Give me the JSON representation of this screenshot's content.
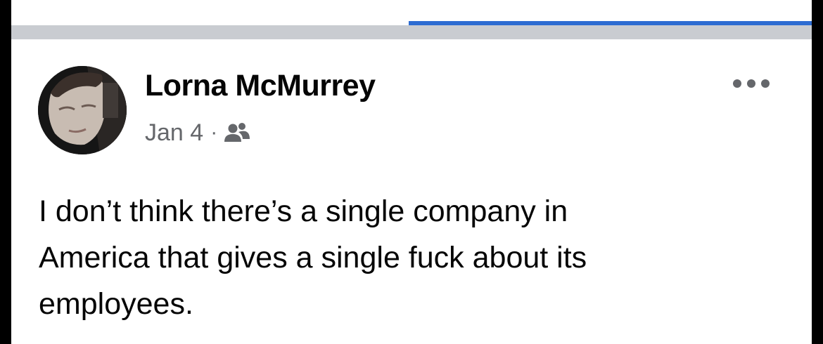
{
  "post": {
    "author": "Lorna McMurrey",
    "date": "Jan 4",
    "separator": "·",
    "audience_icon": "friends-icon",
    "more_icon": "more-options-icon",
    "text_lines": [
      "I don’t think there’s a single company in",
      "America that gives a single fuck about its",
      "employees."
    ]
  },
  "colors": {
    "accent_line": "#2d6cd2",
    "divider": "#c9ccd1",
    "meta_text": "#65676b",
    "primary_text": "#050505"
  }
}
